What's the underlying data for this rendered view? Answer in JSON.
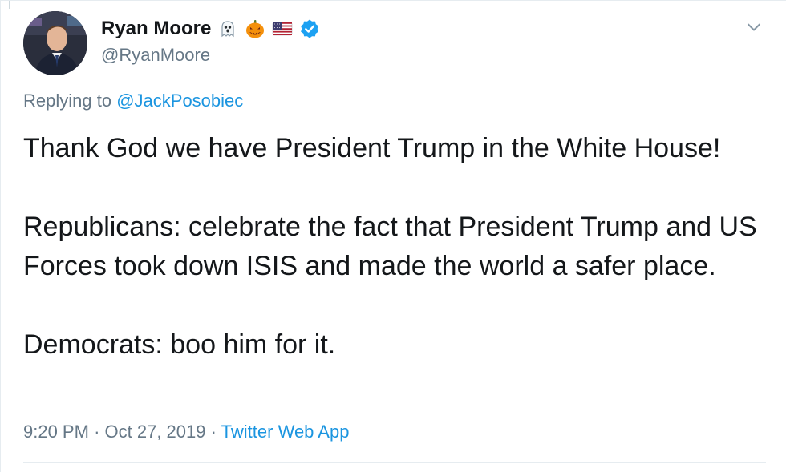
{
  "author": {
    "name": "Ryan Moore",
    "handle": "@RyanMoore",
    "badges": [
      "ghost-emoji",
      "jack-o-lantern-emoji",
      "us-flag-emoji",
      "verified-badge"
    ],
    "verified_color": "#1da1f2"
  },
  "reply": {
    "prefix": "Replying to",
    "mention": "@JackPosobiec"
  },
  "body": {
    "line1": "Thank God we have President Trump in the White House!",
    "line2": "Republicans: celebrate the fact that President Trump and US Forces took down ISIS and made the world a safer place.",
    "line3": "Democrats: boo him for it."
  },
  "meta": {
    "time": "9:20 PM",
    "sep1": "·",
    "date": "Oct 27, 2019",
    "sep2": "·",
    "source": "Twitter Web App"
  },
  "colors": {
    "link": "#1b95e0",
    "secondary_text": "#657786",
    "primary_text": "#14171a"
  }
}
